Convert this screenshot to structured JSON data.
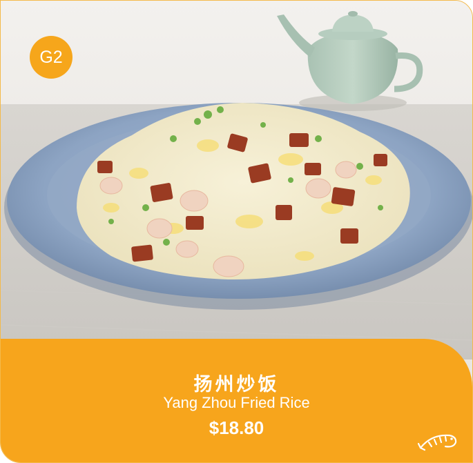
{
  "badge": {
    "code": "G2"
  },
  "item": {
    "name_cn": "扬州炒饭",
    "name_en": "Yang Zhou Fried Rice",
    "price": "$18.80"
  },
  "icons": {
    "category_icon": "shrimp-icon"
  },
  "colors": {
    "accent": "#f7a51c",
    "border": "#f4b949",
    "text": "#ffffff"
  }
}
